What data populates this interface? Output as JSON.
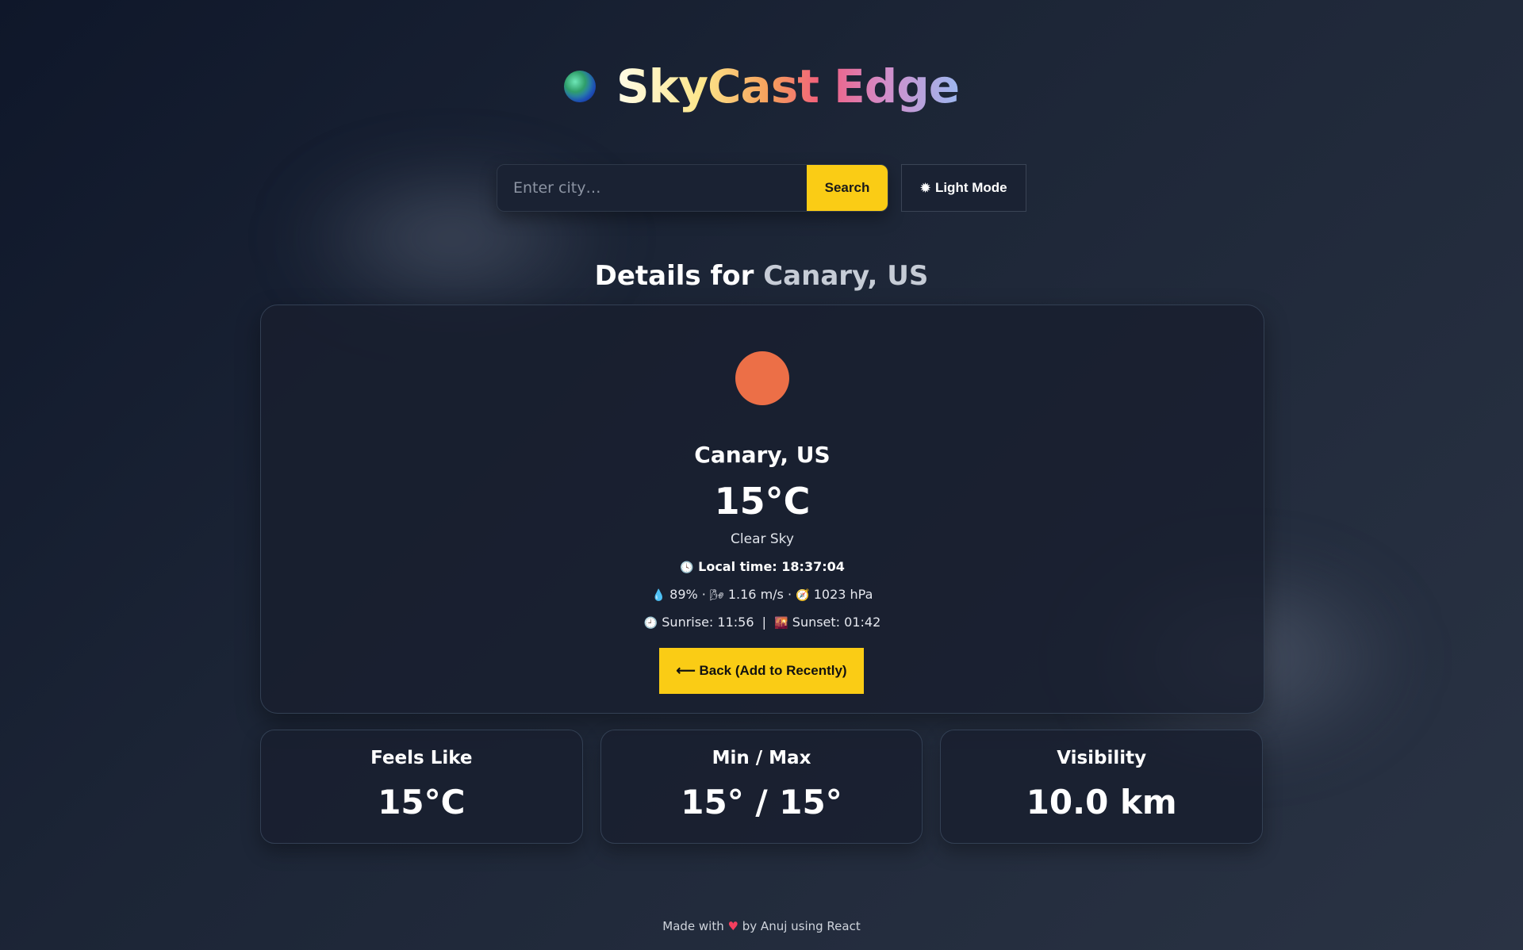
{
  "app": {
    "title": "SkyCast Edge",
    "globe_icon": "globe-icon"
  },
  "search": {
    "placeholder": "Enter city…",
    "value": "",
    "button_label": "Search"
  },
  "theme_toggle": {
    "icon": "sun-icon",
    "label": "Light Mode"
  },
  "details": {
    "prefix": "Details for",
    "city": "Canary, US"
  },
  "weather": {
    "icon": "sun-icon",
    "icon_color": "#ec6f47",
    "city": "Canary, US",
    "temperature": "15°C",
    "description": "Clear Sky",
    "local_time": "Local time: 18:37:04",
    "humidity": "89%",
    "wind": "1.16 m/s",
    "pressure": "1023 hPa",
    "sunrise": "Sunrise: 11:56",
    "sunset": "Sunset: 01:42"
  },
  "back_button": {
    "label": "⟵ Back (Add to Recently)"
  },
  "stats": [
    {
      "label": "Feels Like",
      "value": "15°C"
    },
    {
      "label": "Min / Max",
      "value": "15° / 15°"
    },
    {
      "label": "Visibility",
      "value": "10.0 km"
    }
  ],
  "footer": {
    "prefix": "Made with",
    "heart": "♥",
    "suffix": "by Anuj using React"
  },
  "colors": {
    "accent": "#facc15",
    "background": "#1c2536",
    "card": "#181f2e"
  }
}
